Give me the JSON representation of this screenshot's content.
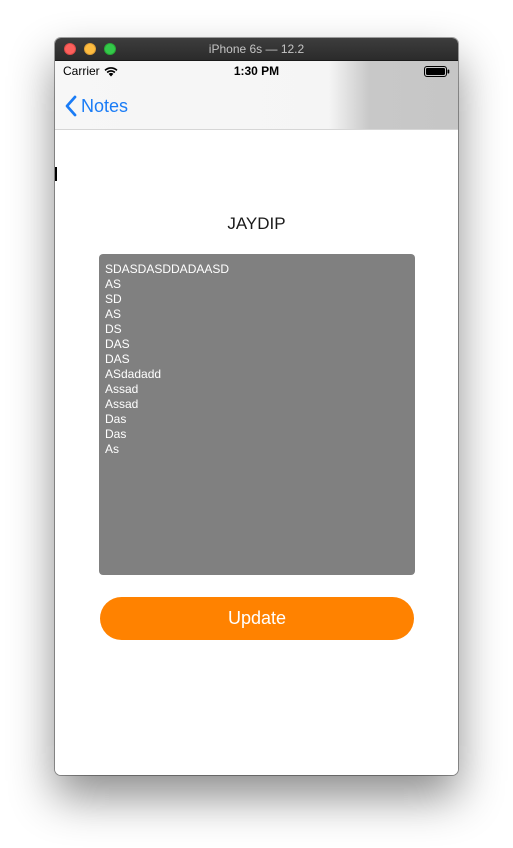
{
  "window": {
    "title": "iPhone 6s — 12.2"
  },
  "status_bar": {
    "carrier": "Carrier",
    "time": "1:30 PM",
    "wifi_icon": "wifi-icon",
    "battery_icon": "battery-full-icon"
  },
  "nav": {
    "back_label": "Notes",
    "back_icon": "chevron-left-icon"
  },
  "note": {
    "title": "JAYDIP",
    "lines": [
      "SDASDASDDADAASD",
      "AS",
      "SD",
      "AS",
      "DS",
      "DAS",
      "DAS",
      "ASdadadd",
      "Assad",
      "Assad",
      "Das",
      "Das",
      "As"
    ]
  },
  "actions": {
    "update_label": "Update"
  },
  "colors": {
    "accent": "#ff8200",
    "link": "#1a7cf6",
    "textarea_bg": "#808080"
  }
}
